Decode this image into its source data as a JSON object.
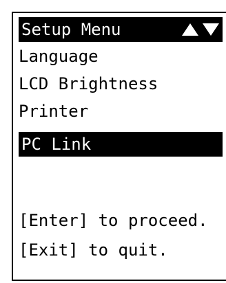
{
  "menu": {
    "title": "Setup Menu",
    "scroll_indicator_icons": [
      "up-triangle-icon",
      "down-triangle-icon"
    ],
    "items": [
      {
        "label": "Language",
        "selected": false
      },
      {
        "label": "LCD Brightness",
        "selected": false
      },
      {
        "label": "Printer",
        "selected": false
      },
      {
        "label": "PC Link",
        "selected": true
      }
    ]
  },
  "hints": {
    "enter": "[Enter] to proceed.",
    "exit": "[Exit] to quit."
  },
  "colors": {
    "background": "#ffffff",
    "text": "#000000",
    "highlight_bg": "#000000",
    "highlight_text": "#ffffff"
  }
}
